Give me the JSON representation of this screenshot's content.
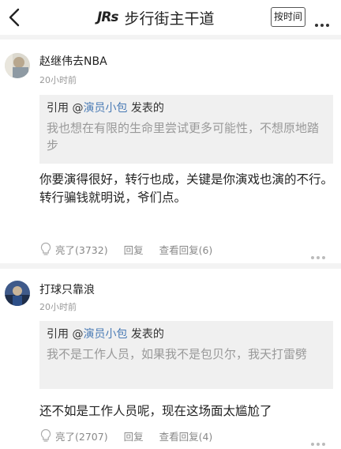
{
  "header": {
    "logo": "JRs",
    "title": "步行街主干道",
    "sort_button": "按时间"
  },
  "comments": [
    {
      "username": "赵继伟去NBA",
      "time": "20小时前",
      "quote": {
        "prefix": "引用 @",
        "author": "演员小包",
        "suffix": " 发表的",
        "text": "我也想在有限的生命里尝试更多可能性，不想原地踏步"
      },
      "text": "你要演得很好，转行也成，关键是你演戏也演的不行。\n转行骗钱就明说，爷们点。",
      "likes": "亮了(3732)",
      "reply": "回复",
      "view_replies": "查看回复(6)"
    },
    {
      "username": "打球只靠浪",
      "time": "20小时前",
      "quote": {
        "prefix": "引用 @",
        "author": "演员小包",
        "suffix": " 发表的",
        "text": "我不是工作人员，如果我不是包贝尔，我天打雷劈"
      },
      "text": "还不如是工作人员呢，现在这场面太尴尬了",
      "likes": "亮了(2707)",
      "reply": "回复",
      "view_replies": "查看回复(4)"
    }
  ],
  "colors": {
    "link": "#4a7bb5",
    "quote_bg": "#f0f0f0",
    "muted": "#999999"
  }
}
